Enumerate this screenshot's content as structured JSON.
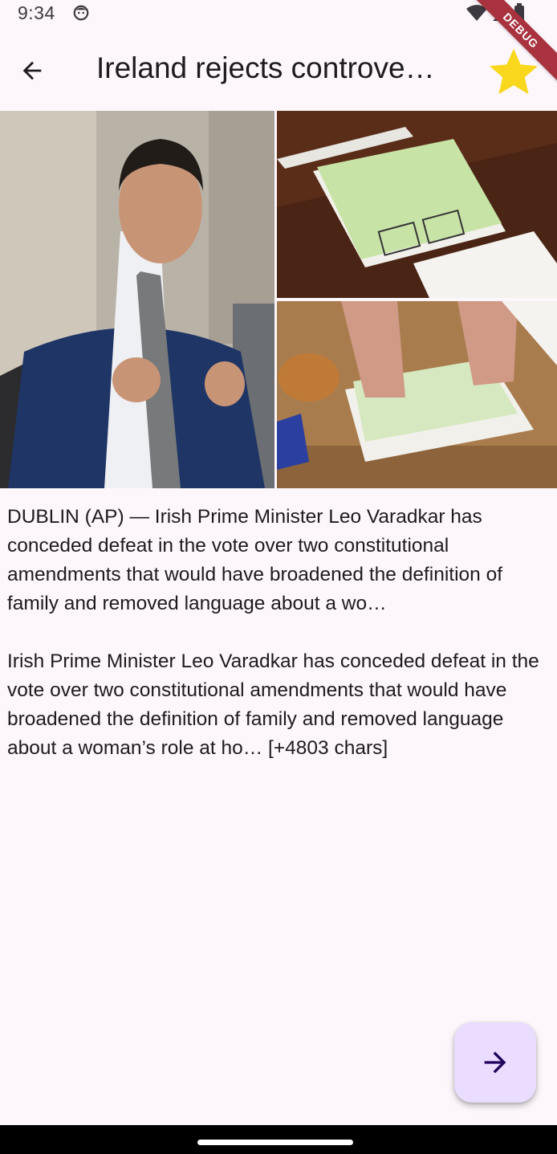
{
  "status_bar": {
    "time": "9:34",
    "icons": [
      "face-icon",
      "wifi-icon",
      "signal-icon",
      "battery-icon"
    ]
  },
  "debug_banner": "DEBUG",
  "app_bar": {
    "title": "Ireland rejects controve…",
    "back_icon": "arrow-back-icon",
    "favorite_icon": "star-icon",
    "favorite_color": "#f9d71c"
  },
  "article": {
    "images": [
      "photo-leo-varadkar",
      "photo-ballot-papers",
      "photo-ballot-counting"
    ],
    "summary": "DUBLIN (AP) — Irish Prime Minister Leo Varadkar has conceded defeat in the vote over two constitutional amendments that would have broadened the definition of family and removed language about a wo…",
    "content": "Irish Prime Minister Leo Varadkar has conceded defeat in the vote over two constitutional amendments that would have broadened the definition of family and removed language about a woman’s role at ho… [+4803 chars]"
  },
  "fab": {
    "icon": "arrow-forward-icon",
    "color": "#eaddff"
  },
  "colors": {
    "background": "#fdf7fb",
    "text": "#1d1b20",
    "fab_icon": "#21005d"
  }
}
